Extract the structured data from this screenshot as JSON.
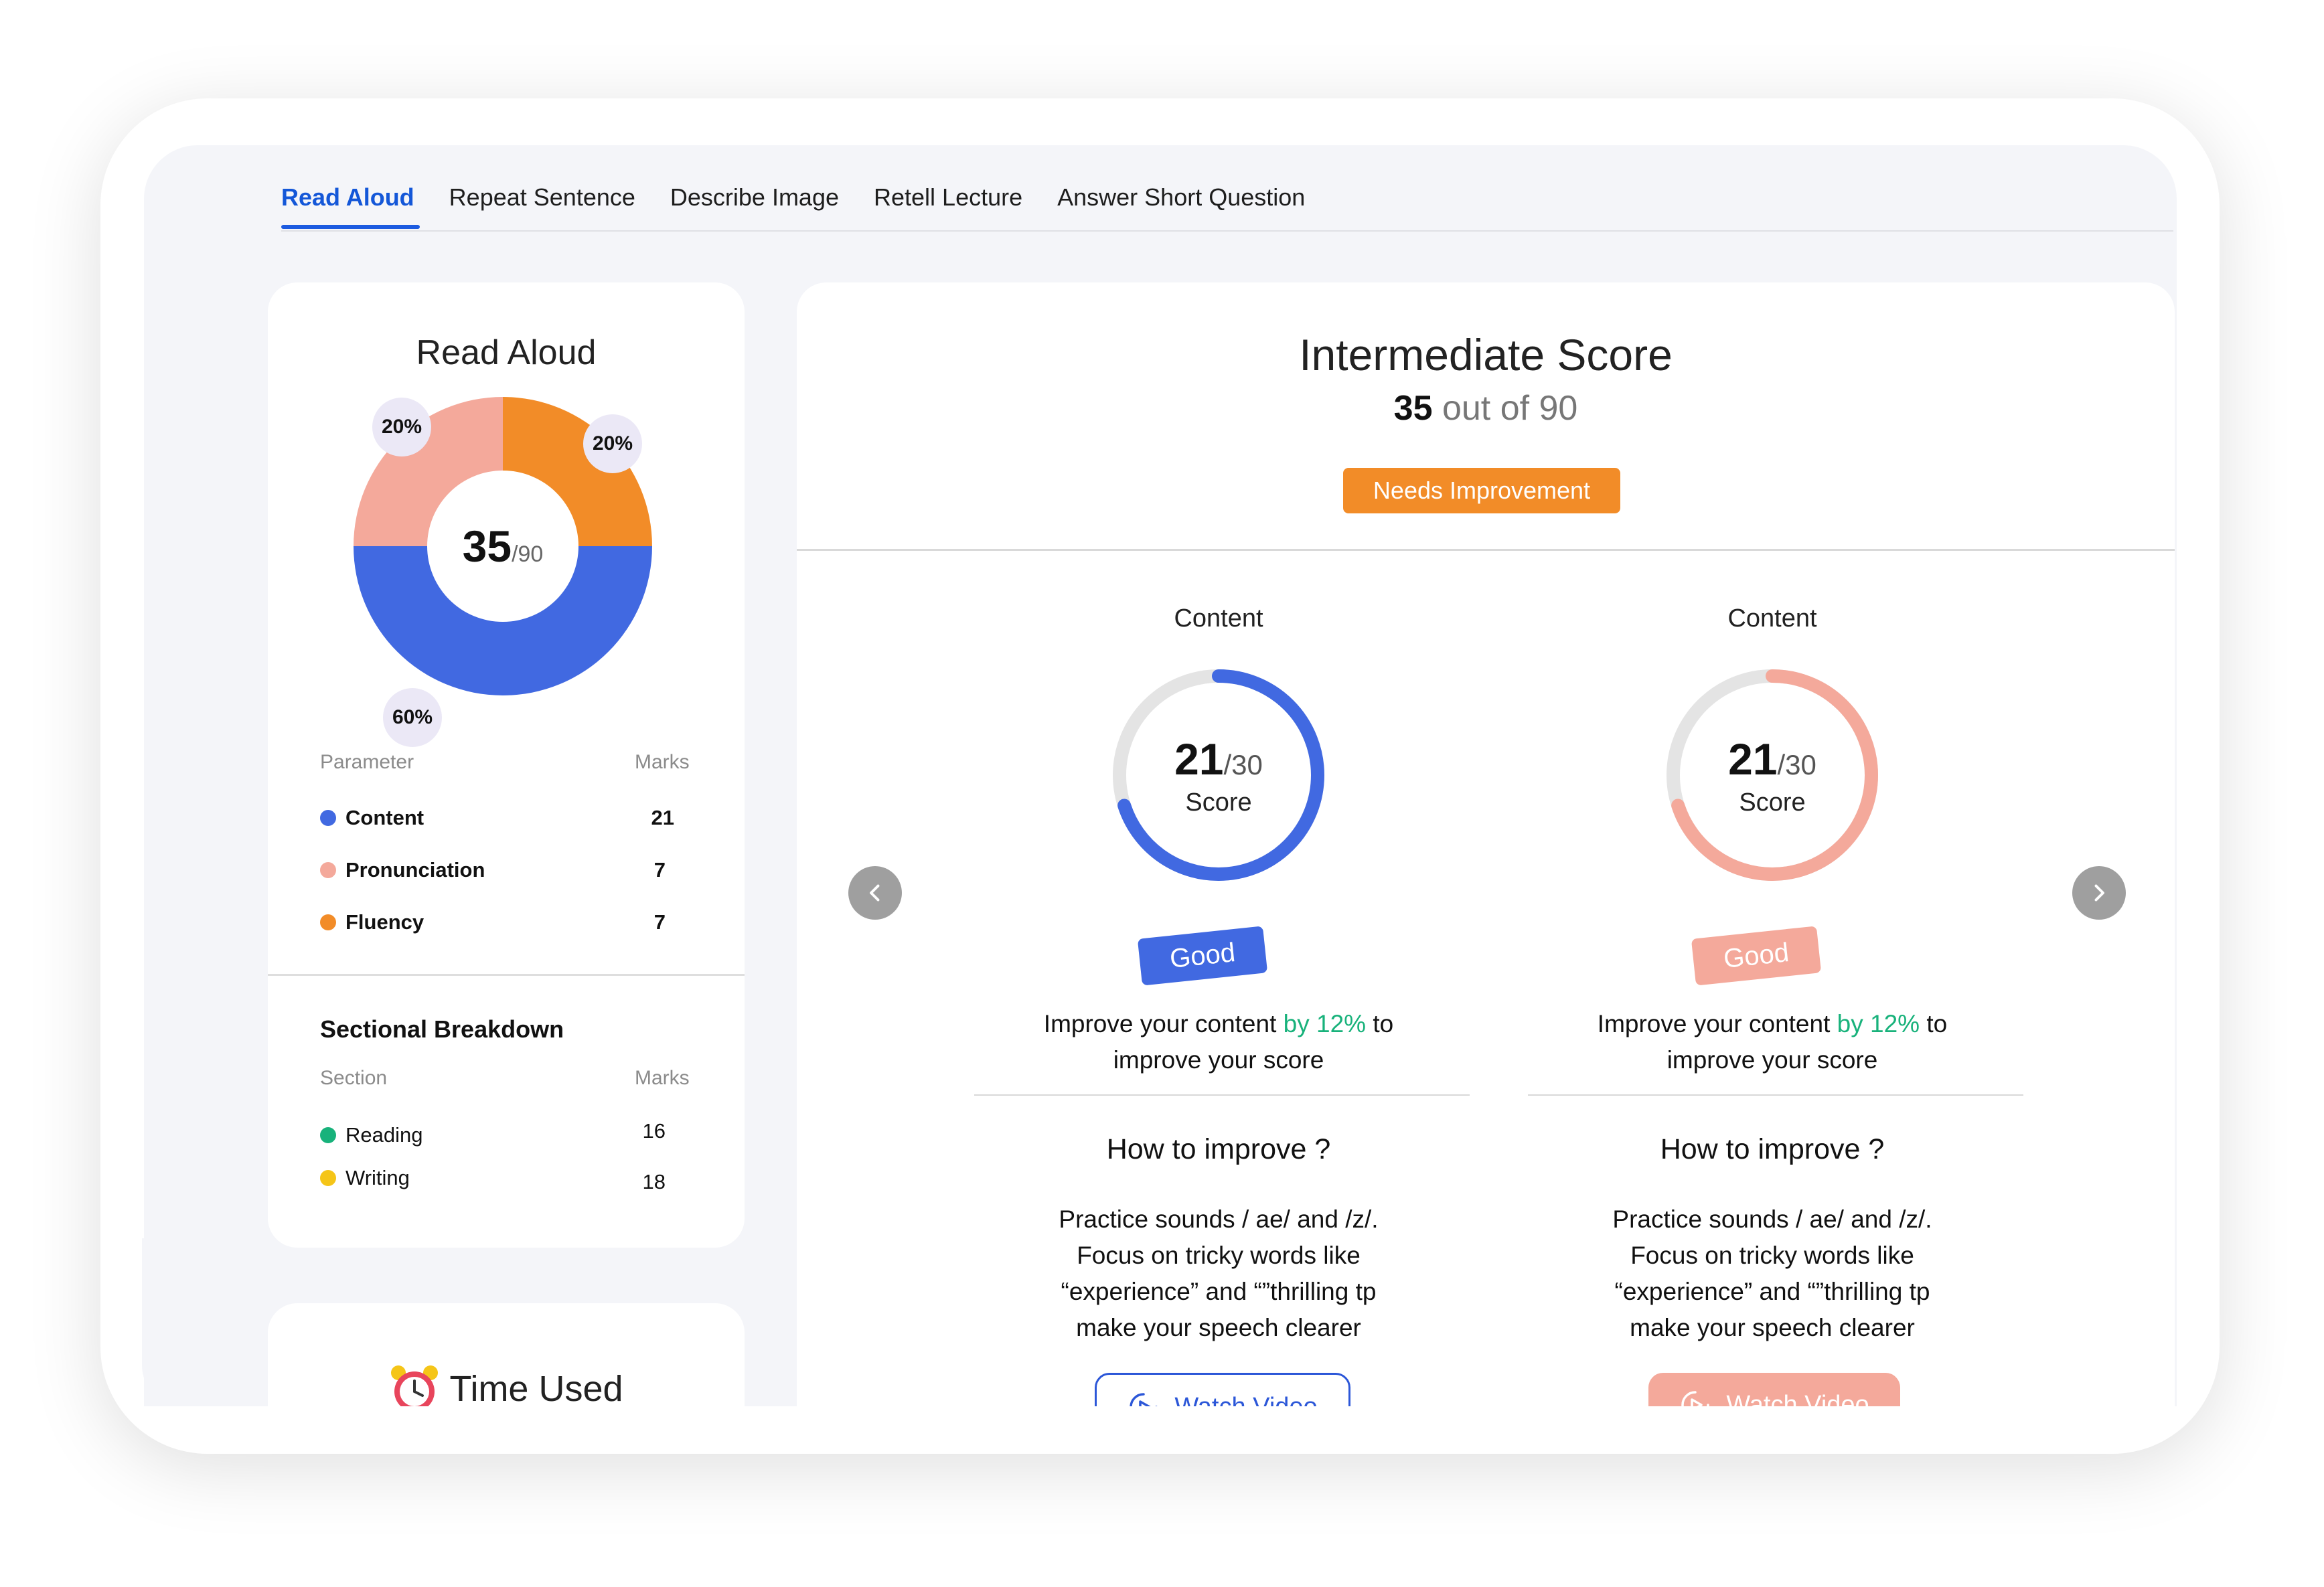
{
  "tabs": [
    "Read Aloud",
    "Repeat Sentence",
    "Describe Image",
    "Retell Lecture",
    "Answer Short Question"
  ],
  "active_tab": "Read Aloud",
  "left_card": {
    "title": "Read Aloud",
    "donut": {
      "score": "35",
      "total": "/90",
      "segments": [
        {
          "name": "Fluency",
          "percent": "20%",
          "color": "#f28c28"
        },
        {
          "name": "Content",
          "percent": "60%",
          "color": "#4169e1"
        },
        {
          "name": "Pronunciation",
          "percent": "20%",
          "color": "#f4a99b"
        }
      ]
    },
    "param_header": {
      "left": "Parameter",
      "right": "Marks"
    },
    "params": [
      {
        "label": "Content",
        "value": "21",
        "color": "#4169e1"
      },
      {
        "label": "Pronunciation",
        "value": "7",
        "color": "#f4a99b"
      },
      {
        "label": "Fluency",
        "value": "7",
        "color": "#f28c28"
      }
    ],
    "sectional_title": "Sectional Breakdown",
    "section_header": {
      "left": "Section",
      "right": "Marks"
    },
    "sections": [
      {
        "label": "Reading",
        "value": "16",
        "color": "#18b27b"
      },
      {
        "label": "Writing",
        "value": "18",
        "color": "#f5c518"
      }
    ]
  },
  "time_card": {
    "title": "Time Used",
    "icon": "alarm-clock-icon"
  },
  "main": {
    "title": "Intermediate Score",
    "score": "35",
    "out_of": "out of 90",
    "badge": "Needs Improvement",
    "columns": [
      {
        "title": "Content",
        "score": "21",
        "total": "/30",
        "score_label": "Score",
        "progress": 0.7,
        "color": "#4169e1",
        "tag": "Good",
        "improve_pre": "Improve your content ",
        "improve_hl": "by 12%",
        "improve_post": " to",
        "improve_line2": "improve your score",
        "how_title": "How to improve ?",
        "tips": [
          "Practice sounds / ae/ and /z/.",
          "Focus on tricky words like",
          "“experience” and “”thrilling  tp",
          "make your speech clearer"
        ],
        "watch_label": "Watch Video"
      },
      {
        "title": "Content",
        "score": "21",
        "total": "/30",
        "score_label": "Score",
        "progress": 0.7,
        "color": "#f4a99b",
        "tag": "Good",
        "improve_pre": "Improve your content ",
        "improve_hl": "by 12%",
        "improve_post": " to",
        "improve_line2": "improve your score",
        "how_title": "How to improve ?",
        "tips": [
          "Practice sounds / ae/ and /z/.",
          "Focus on tricky words like",
          "“experience” and “”thrilling  tp",
          "make your speech clearer"
        ],
        "watch_label": "Watch Video"
      }
    ]
  },
  "icons": {
    "prev": "chevron-left-icon",
    "next": "chevron-right-icon",
    "video": "play-circle-icon"
  }
}
